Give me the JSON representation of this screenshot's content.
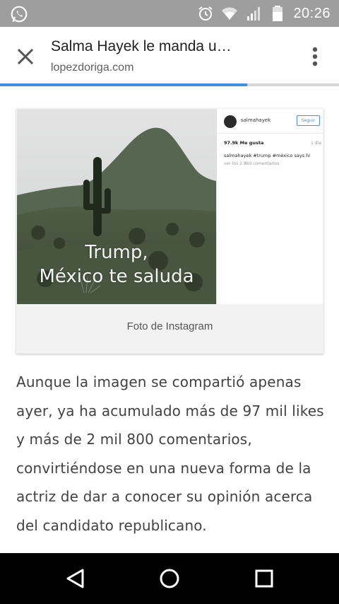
{
  "status_bar": {
    "time": "20:26",
    "icons": [
      "whatsapp-icon",
      "alarm-icon",
      "wifi-icon",
      "signal-icon",
      "battery-icon"
    ]
  },
  "toolbar": {
    "title": "Salma Hayek le manda u…",
    "url": "lopezdoriga.com",
    "load_progress": 0.73
  },
  "figure": {
    "overlay_line1": "Trump,",
    "overlay_line2": "México te saluda",
    "caption": "Foto de Instagram",
    "instagram": {
      "username": "salmahayek",
      "follow_label": "Seguir",
      "likes": "97.9k Me gusta",
      "age": "1 día",
      "caption": "salmahayek #trump #méxico says hi",
      "comments": "ver los 2.860 comentarios"
    }
  },
  "article": {
    "paragraph": "Aunque la imagen se compartió apenas ayer, ya ha acumulado más de 97 mil likes y más de 2 mil 800 comentarios, convirtiéndose en una nueva forma de la actriz de dar a conocer su opinión acerca del candidato republicano."
  },
  "colors": {
    "status_bar": "#9e9e9e",
    "progress_fill": "#3f8fe0",
    "nav_bar": "#000000"
  }
}
